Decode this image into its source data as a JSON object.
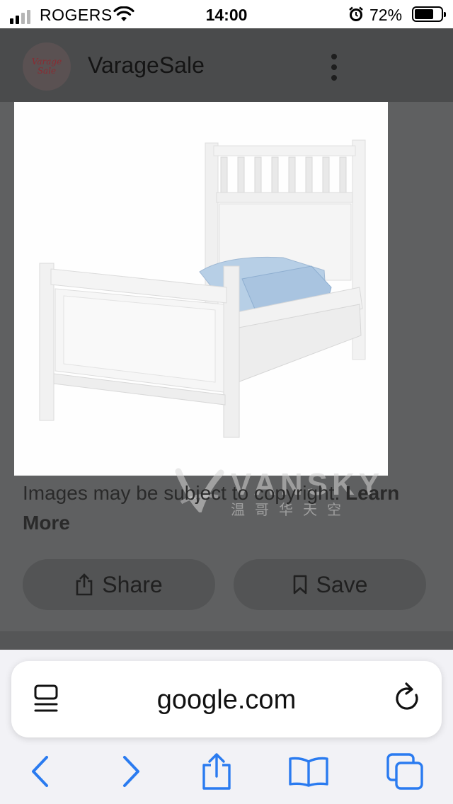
{
  "status_bar": {
    "carrier": "ROGERS",
    "time": "14:00",
    "battery_percent": "72%",
    "battery_level": 0.72,
    "icons": [
      "signal-icon",
      "wifi-icon",
      "alarm-icon",
      "battery-icon"
    ]
  },
  "site": {
    "logo_text_line1": "Varage",
    "logo_text_line2": "Sale",
    "name": "VarageSale",
    "menu_icon": "kebab-menu-icon"
  },
  "watermark": {
    "text": "VANSKY",
    "subtext": "温哥华天空"
  },
  "disclaimer": {
    "text": "Images may be subject to copyright.",
    "link": "Learn More"
  },
  "actions": {
    "share_label": "Share",
    "save_label": "Save"
  },
  "browser": {
    "url": "google.com",
    "toolbar_icons": [
      "back-arrow-icon",
      "forward-arrow-icon",
      "share-icon",
      "bookmarks-icon",
      "tabs-icon"
    ]
  },
  "colors": {
    "accent": "#2a7bf0",
    "overlay": "#5f6061"
  }
}
